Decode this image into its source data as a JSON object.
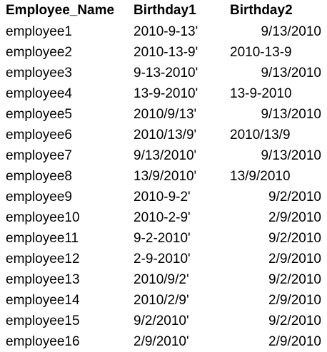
{
  "table": {
    "headers": [
      "Employee_Name",
      "Birthday1",
      "Birthday2"
    ],
    "rows": [
      {
        "name": "employee1",
        "birthday1": "2010-9-13'",
        "birthday2": "9/13/2010",
        "b2_align": "right"
      },
      {
        "name": "employee2",
        "birthday1": "2010-13-9'",
        "birthday2": "2010-13-9",
        "b2_align": "left"
      },
      {
        "name": "employee3",
        "birthday1": "9-13-2010'",
        "birthday2": "9/13/2010",
        "b2_align": "right"
      },
      {
        "name": "employee4",
        "birthday1": "13-9-2010'",
        "birthday2": "13-9-2010",
        "b2_align": "left"
      },
      {
        "name": "employee5",
        "birthday1": "2010/9/13'",
        "birthday2": "9/13/2010",
        "b2_align": "right"
      },
      {
        "name": "employee6",
        "birthday1": "2010/13/9'",
        "birthday2": "2010/13/9",
        "b2_align": "left"
      },
      {
        "name": "employee7",
        "birthday1": "9/13/2010'",
        "birthday2": "9/13/2010",
        "b2_align": "right"
      },
      {
        "name": "employee8",
        "birthday1": "13/9/2010'",
        "birthday2": "13/9/2010",
        "b2_align": "left"
      },
      {
        "name": "employee9",
        "birthday1": "2010-9-2'",
        "birthday2": "9/2/2010",
        "b2_align": "right"
      },
      {
        "name": "employee10",
        "birthday1": "2010-2-9'",
        "birthday2": "2/9/2010",
        "b2_align": "right"
      },
      {
        "name": "employee11",
        "birthday1": "9-2-2010'",
        "birthday2": "9/2/2010",
        "b2_align": "right"
      },
      {
        "name": "employee12",
        "birthday1": "2-9-2010'",
        "birthday2": "2/9/2010",
        "b2_align": "right"
      },
      {
        "name": "employee13",
        "birthday1": "2010/9/2'",
        "birthday2": "9/2/2010",
        "b2_align": "right"
      },
      {
        "name": "employee14",
        "birthday1": "2010/2/9'",
        "birthday2": "2/9/2010",
        "b2_align": "right"
      },
      {
        "name": "employee15",
        "birthday1": "9/2/2010'",
        "birthday2": "9/2/2010",
        "b2_align": "right"
      },
      {
        "name": "employee16",
        "birthday1": "2/9/2010'",
        "birthday2": "2/9/2010",
        "b2_align": "right"
      }
    ]
  }
}
